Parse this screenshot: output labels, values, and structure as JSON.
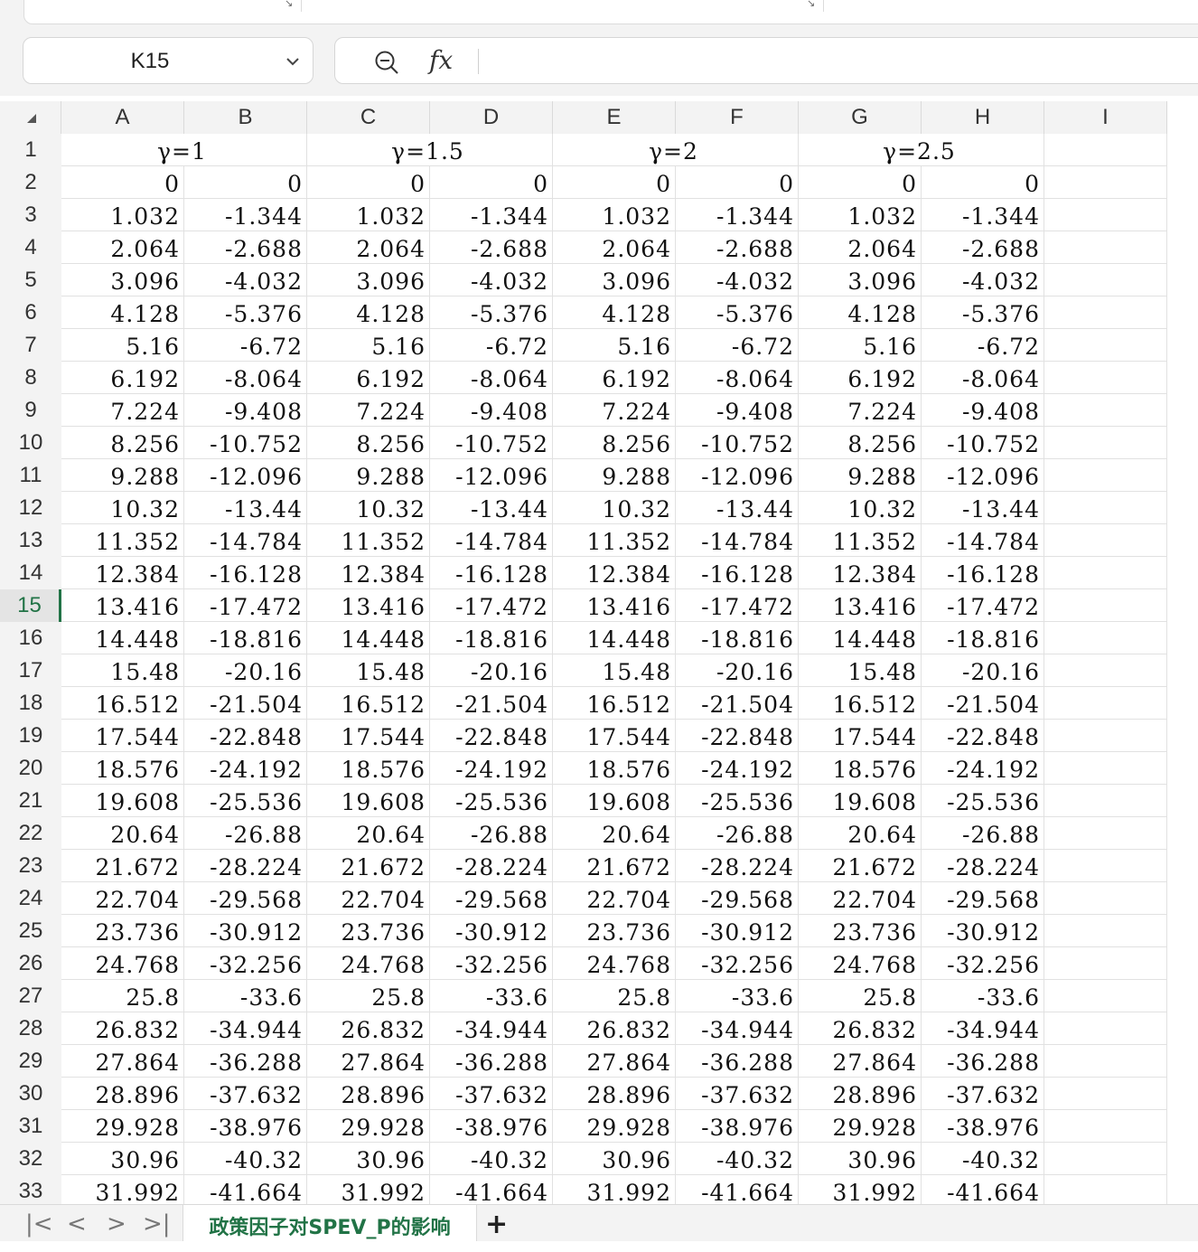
{
  "name_box": {
    "value": "K15"
  },
  "formula_bar": {
    "zoom_icon": "zoom-out-icon",
    "fx_label": "fx",
    "formula": ""
  },
  "columns": [
    "A",
    "B",
    "C",
    "D",
    "E",
    "F",
    "G",
    "H",
    "I"
  ],
  "row_numbers": [
    "1",
    "2",
    "3",
    "4",
    "5",
    "6",
    "7",
    "8",
    "9",
    "10",
    "11",
    "12",
    "13",
    "14",
    "15",
    "16",
    "17",
    "18",
    "19",
    "20",
    "21",
    "22",
    "23",
    "24",
    "25",
    "26",
    "27",
    "28",
    "29",
    "30",
    "31",
    "32",
    "33"
  ],
  "active_row": 15,
  "header_row": [
    "γ=1",
    "γ=1.5",
    "γ=2",
    "γ=2.5"
  ],
  "data_rows": [
    [
      "0",
      "0",
      "0",
      "0",
      "0",
      "0",
      "0",
      "0"
    ],
    [
      "1.032",
      "-1.344",
      "1.032",
      "-1.344",
      "1.032",
      "-1.344",
      "1.032",
      "-1.344"
    ],
    [
      "2.064",
      "-2.688",
      "2.064",
      "-2.688",
      "2.064",
      "-2.688",
      "2.064",
      "-2.688"
    ],
    [
      "3.096",
      "-4.032",
      "3.096",
      "-4.032",
      "3.096",
      "-4.032",
      "3.096",
      "-4.032"
    ],
    [
      "4.128",
      "-5.376",
      "4.128",
      "-5.376",
      "4.128",
      "-5.376",
      "4.128",
      "-5.376"
    ],
    [
      "5.16",
      "-6.72",
      "5.16",
      "-6.72",
      "5.16",
      "-6.72",
      "5.16",
      "-6.72"
    ],
    [
      "6.192",
      "-8.064",
      "6.192",
      "-8.064",
      "6.192",
      "-8.064",
      "6.192",
      "-8.064"
    ],
    [
      "7.224",
      "-9.408",
      "7.224",
      "-9.408",
      "7.224",
      "-9.408",
      "7.224",
      "-9.408"
    ],
    [
      "8.256",
      "-10.752",
      "8.256",
      "-10.752",
      "8.256",
      "-10.752",
      "8.256",
      "-10.752"
    ],
    [
      "9.288",
      "-12.096",
      "9.288",
      "-12.096",
      "9.288",
      "-12.096",
      "9.288",
      "-12.096"
    ],
    [
      "10.32",
      "-13.44",
      "10.32",
      "-13.44",
      "10.32",
      "-13.44",
      "10.32",
      "-13.44"
    ],
    [
      "11.352",
      "-14.784",
      "11.352",
      "-14.784",
      "11.352",
      "-14.784",
      "11.352",
      "-14.784"
    ],
    [
      "12.384",
      "-16.128",
      "12.384",
      "-16.128",
      "12.384",
      "-16.128",
      "12.384",
      "-16.128"
    ],
    [
      "13.416",
      "-17.472",
      "13.416",
      "-17.472",
      "13.416",
      "-17.472",
      "13.416",
      "-17.472"
    ],
    [
      "14.448",
      "-18.816",
      "14.448",
      "-18.816",
      "14.448",
      "-18.816",
      "14.448",
      "-18.816"
    ],
    [
      "15.48",
      "-20.16",
      "15.48",
      "-20.16",
      "15.48",
      "-20.16",
      "15.48",
      "-20.16"
    ],
    [
      "16.512",
      "-21.504",
      "16.512",
      "-21.504",
      "16.512",
      "-21.504",
      "16.512",
      "-21.504"
    ],
    [
      "17.544",
      "-22.848",
      "17.544",
      "-22.848",
      "17.544",
      "-22.848",
      "17.544",
      "-22.848"
    ],
    [
      "18.576",
      "-24.192",
      "18.576",
      "-24.192",
      "18.576",
      "-24.192",
      "18.576",
      "-24.192"
    ],
    [
      "19.608",
      "-25.536",
      "19.608",
      "-25.536",
      "19.608",
      "-25.536",
      "19.608",
      "-25.536"
    ],
    [
      "20.64",
      "-26.88",
      "20.64",
      "-26.88",
      "20.64",
      "-26.88",
      "20.64",
      "-26.88"
    ],
    [
      "21.672",
      "-28.224",
      "21.672",
      "-28.224",
      "21.672",
      "-28.224",
      "21.672",
      "-28.224"
    ],
    [
      "22.704",
      "-29.568",
      "22.704",
      "-29.568",
      "22.704",
      "-29.568",
      "22.704",
      "-29.568"
    ],
    [
      "23.736",
      "-30.912",
      "23.736",
      "-30.912",
      "23.736",
      "-30.912",
      "23.736",
      "-30.912"
    ],
    [
      "24.768",
      "-32.256",
      "24.768",
      "-32.256",
      "24.768",
      "-32.256",
      "24.768",
      "-32.256"
    ],
    [
      "25.8",
      "-33.6",
      "25.8",
      "-33.6",
      "25.8",
      "-33.6",
      "25.8",
      "-33.6"
    ],
    [
      "26.832",
      "-34.944",
      "26.832",
      "-34.944",
      "26.832",
      "-34.944",
      "26.832",
      "-34.944"
    ],
    [
      "27.864",
      "-36.288",
      "27.864",
      "-36.288",
      "27.864",
      "-36.288",
      "27.864",
      "-36.288"
    ],
    [
      "28.896",
      "-37.632",
      "28.896",
      "-37.632",
      "28.896",
      "-37.632",
      "28.896",
      "-37.632"
    ],
    [
      "29.928",
      "-38.976",
      "29.928",
      "-38.976",
      "29.928",
      "-38.976",
      "29.928",
      "-38.976"
    ],
    [
      "30.96",
      "-40.32",
      "30.96",
      "-40.32",
      "30.96",
      "-40.32",
      "30.96",
      "-40.32"
    ],
    [
      "31.992",
      "-41.664",
      "31.992",
      "-41.664",
      "31.992",
      "-41.664",
      "31.992",
      "-41.664"
    ]
  ],
  "sheet_tabs": {
    "nav_first": "|<",
    "nav_prev": "<",
    "nav_next": ">",
    "nav_last": ">|",
    "active": "政策因子对SPEV_P的影响",
    "add": "+"
  },
  "colors": {
    "accent": "#217346",
    "header_bg": "#f3f3f3",
    "grid_line": "#e1e1e1"
  }
}
